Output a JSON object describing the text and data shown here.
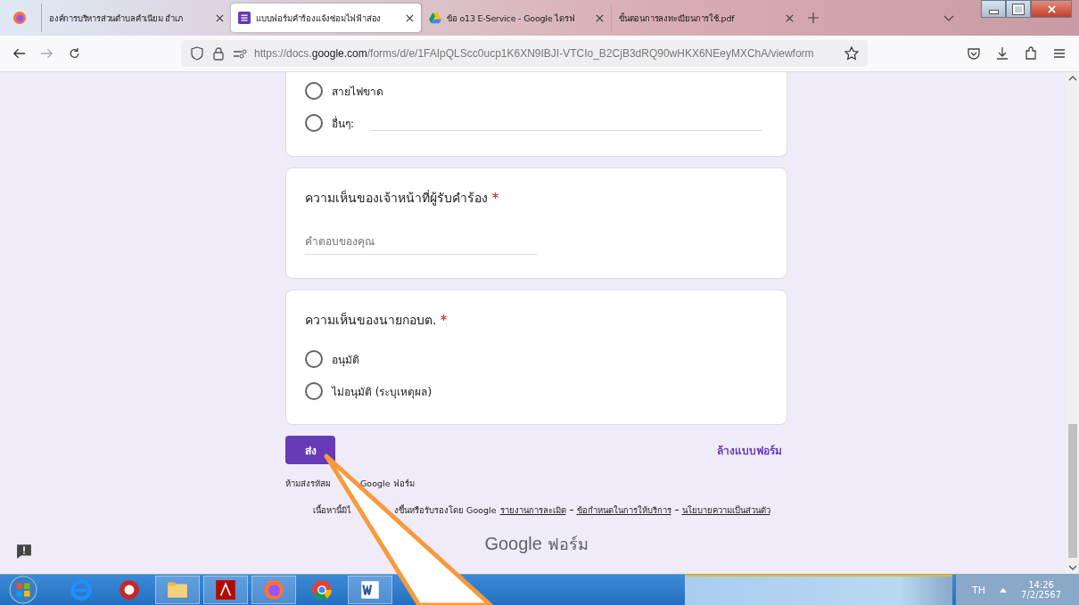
{
  "tabs": [
    {
      "label": "องค์การบริหารส่วนตำบลคำเนียม อำเภ",
      "selected": false,
      "kind": "plain"
    },
    {
      "label": "แบบฟอร์มคำร้องแจ้งซ่อมไฟฟ้าส่อง",
      "selected": true,
      "kind": "form"
    },
    {
      "label": "ข้อ o13 E-Service - Google ไดรฟ",
      "selected": false,
      "kind": "drive"
    },
    {
      "label": "ขั้นตอนการลงทะเบียนการใช้.pdf",
      "selected": false,
      "kind": "plain"
    }
  ],
  "url": {
    "prefix": "https://docs.",
    "host": "google.com",
    "path": "/forms/d/e/1FAIpQLScc0ucp1K6XN9IBJI-VTCIo_B2CjB3dRQ90wHKX6NEeyMXChA/viewform"
  },
  "questions": [
    {
      "kind": "choice",
      "options": [
        {
          "label": "สายไฟขาด",
          "selected": false,
          "kind": "plain"
        },
        {
          "label": "อื่นๆ:",
          "selected": false,
          "kind": "other"
        }
      ]
    },
    {
      "kind": "text",
      "title": "ความเห็นของเจ้าหน้าที่ผู้รับคำร้อง",
      "required": true,
      "placeholder": "คำตอบของคุณ"
    },
    {
      "kind": "choice",
      "title": "ความเห็นของนายกอบต.",
      "required": true,
      "options": [
        {
          "label": "อนุมัติ",
          "selected": false,
          "kind": "plain"
        },
        {
          "label": "ไม่อนุมัติ (ระบุเหตุผล)",
          "selected": false,
          "kind": "plain"
        }
      ]
    }
  ],
  "submit": "ส่ง",
  "clear": "ล้างแบบฟอร์ม",
  "warning": [
    "ห้ามส่งรหัสผ",
    "Google ฟอร์ม"
  ],
  "footer": {
    "parts": [
      "เนื้อหานี้มิไ",
      "งขึ้นหรือรับรองโดย Google"
    ],
    "links": [
      "รายงานการละเมิด",
      "ข้อกำหนดในการให้บริการ",
      "นโยบายความเป็นส่วนตัว"
    ]
  },
  "brand": [
    "Google",
    "ฟอร์ม"
  ],
  "taskbar": {
    "language": "TH",
    "time": "14:26",
    "date": "7/2/2567"
  }
}
